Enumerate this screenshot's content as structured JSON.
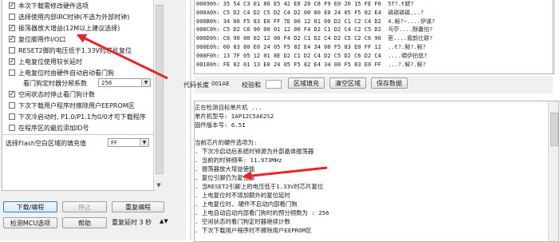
{
  "options": {
    "items": [
      {
        "label": "本次下载需修改硬件选项",
        "checked": true
      },
      {
        "label": "选择使用内部IRC时钟(不选为外部时钟)",
        "checked": false
      },
      {
        "label": "振荡器放大增益(12M以上建议选择)",
        "checked": true
      },
      {
        "label": "复位脚用作I/O口",
        "checked": true
      },
      {
        "label": "RESET2脚的电压低于1.33V时芯片复位",
        "checked": false
      },
      {
        "label": "上电复位使用较长延时",
        "checked": true
      },
      {
        "label": "上电复位时由硬件自动启动看门狗",
        "checked": false
      }
    ],
    "watchdog": {
      "label": "看门狗定时器分频系数",
      "value": "256"
    },
    "items2": [
      {
        "label": "空闲状态时停止看门狗计数",
        "checked": true
      },
      {
        "label": "下次下载用户程序时擦除用户EEPROM区",
        "checked": false
      },
      {
        "label": "下次冷启动时, P1.0/P1.1为0/0才可下载程序",
        "checked": false
      },
      {
        "label": "在程序区的最后添加ID号",
        "checked": false
      }
    ],
    "fill": {
      "label": "选择Flash空白区域的填充值",
      "value": "FF"
    }
  },
  "buttons": {
    "download": "下载/编程",
    "stop": "停止",
    "reprogram": "重复编程",
    "detect": "检测MCU选项",
    "help": "帮助",
    "retry_delay": "重复延时 3 秒"
  },
  "hex": {
    "lines": [
      {
        "addr": "00090h",
        "bytes": "35 54 C3 01 80 E5 42 E8 20 C8 F9 E0 20 15 FE F0",
        "ascii": "5T?.€錌?"
      },
      {
        "addr": "000A0h",
        "bytes": "C5 D2 C4 D2 C5 D2 C4 D2 00 00 E0 24 05 F5 82 E4",
        "ascii": "磷磷磷磷...?"
      },
      {
        "addr": "000B0h",
        "bytes": "34 00 F5 83 E0 FF 7E 00 12 01 00 D2 C1 C2 C4 D2",
        "ascii": "4.鮾?~....伊谋?"
      },
      {
        "addr": "000C0h",
        "bytes": "C5 D2 C6 90 00 01 12 00 F4 D2 C1 D2 C4 C2 C5 D2",
        "ascii": "乓苧....酥囊怕?"
      },
      {
        "addr": "000D0h",
        "bytes": "C6 90 00 02 12 00 F4 D2 C1 D2 C4 D2 C5 C2 C6 90",
        "ascii": "茞....裔鹊仕聠?"
      },
      {
        "addr": "000E0h",
        "bytes": "00 03 80 E0 24 05 F5 82 E4 34 00 F5 83 E0 FF 12",
        "ascii": "..€?.鮾?.鮾?"
      },
      {
        "addr": "000F0h",
        "bytes": "13 7F 05 12 01 8E D2 C1 D2 C4 D2 C5 D2 C6 D2 C4",
        "ascii": "....嚼伊拍悠?"
      },
      {
        "addr": "00100h",
        "bytes": "FE 02 01 13 E0 24 05 F5 82 E4 34 00 F5 83 E0 FF",
        "ascii": "...?.鮾?.鮾?"
      }
    ],
    "code_len_label": "代码长度",
    "code_len_value": "001AE",
    "checksum_label": "校验和",
    "fill_btn": "区域填充",
    "clear_btn": "清空区域",
    "save_btn": "保存数据"
  },
  "log": {
    "lines": [
      "正在检测目标单片机 ...",
      "  单片机型号: IAP12C5A62S2",
      "  固件版本号: 6.5I",
      "",
      "当前芯片的硬件选项为:",
      "  . 下次冷启动后系统时钟源为外部晶体振荡器",
      "  . 当前的时钟频率: 11.973MHz",
      "  . 振荡器放大增益使能",
      "  . 复位引脚仍为复位脚",
      "  . 当RESET2引脚上的电压低于1.33V时芯片复位",
      "  . 上电复位时不增加额外的复位延时",
      "  . 上电复位时, 硬件不启动内部看门狗",
      "  . 上电自动启动内部看门狗时的预分频数为 : 256",
      "  . 空闲状态时看门狗定时器继续计数",
      "  . 下次下载用户程序时不擦除用户EEPROM区"
    ]
  }
}
